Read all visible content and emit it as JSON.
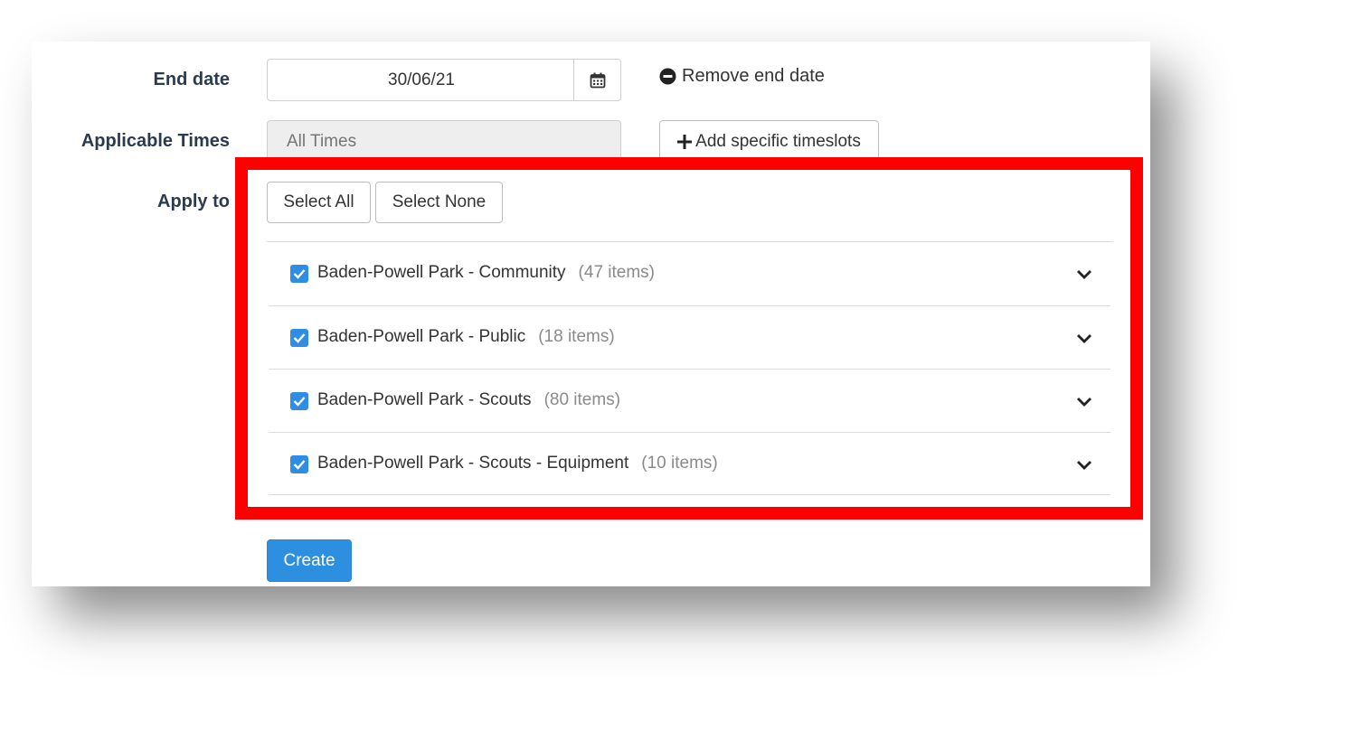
{
  "form": {
    "end_date": {
      "label": "End date",
      "value": "30/06/21",
      "calendar_icon": "calendar-icon",
      "remove_label": "Remove end date",
      "remove_icon": "minus-circle-icon"
    },
    "applicable_times": {
      "label": "Applicable Times",
      "placeholder": "All Times",
      "add_label": "Add specific timeslots",
      "add_icon": "plus-icon"
    },
    "apply_to": {
      "label": "Apply to",
      "select_all_label": "Select All",
      "select_none_label": "Select None",
      "items": [
        {
          "name": "Baden-Powell Park - Community",
          "count": "(47 items)",
          "checked": true
        },
        {
          "name": "Baden-Powell Park - Public",
          "count": "(18 items)",
          "checked": true
        },
        {
          "name": "Baden-Powell Park - Scouts",
          "count": "(80 items)",
          "checked": true
        },
        {
          "name": "Baden-Powell Park - Scouts - Equipment",
          "count": "(10 items)",
          "checked": true
        }
      ]
    },
    "create_label": "Create"
  },
  "colors": {
    "accent": "#2d8fe0",
    "highlight_border": "#ff0000",
    "label_text": "#2b3b4e"
  }
}
